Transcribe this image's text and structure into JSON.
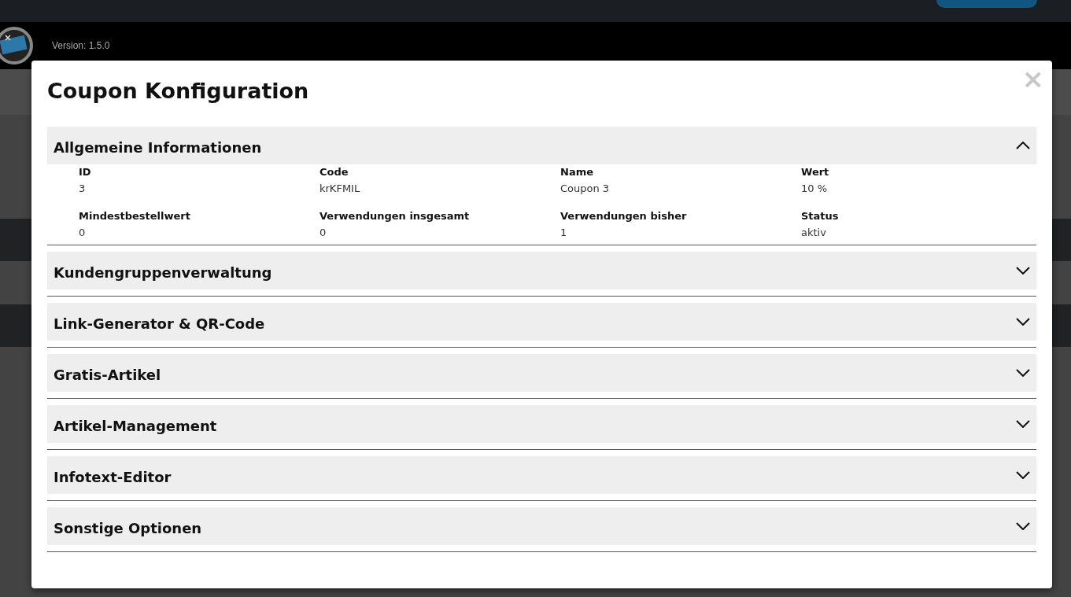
{
  "header": {
    "version": "Version: 1.5.0"
  },
  "modal": {
    "title": "Coupon Konfiguration",
    "close": "×",
    "sections": [
      {
        "title": "Allgemeine Informationen",
        "expanded": true,
        "fields": [
          {
            "label": "ID",
            "value": "3"
          },
          {
            "label": "Code",
            "value": "krKFMIL"
          },
          {
            "label": "Name",
            "value": "Coupon 3"
          },
          {
            "label": "Wert",
            "value": "10 %"
          },
          {
            "label": "Mindestbestellwert",
            "value": "0"
          },
          {
            "label": "Verwendungen insgesamt",
            "value": "0"
          },
          {
            "label": "Verwendungen bisher",
            "value": "1"
          },
          {
            "label": "Status",
            "value": "aktiv"
          }
        ]
      },
      {
        "title": "Kundengruppenverwaltung",
        "expanded": false
      },
      {
        "title": "Link-Generator & QR-Code",
        "expanded": false
      },
      {
        "title": "Gratis-Artikel",
        "expanded": false
      },
      {
        "title": "Artikel-Management",
        "expanded": false
      },
      {
        "title": "Infotext-Editor",
        "expanded": false
      },
      {
        "title": "Sonstige Optionen",
        "expanded": false
      }
    ]
  }
}
